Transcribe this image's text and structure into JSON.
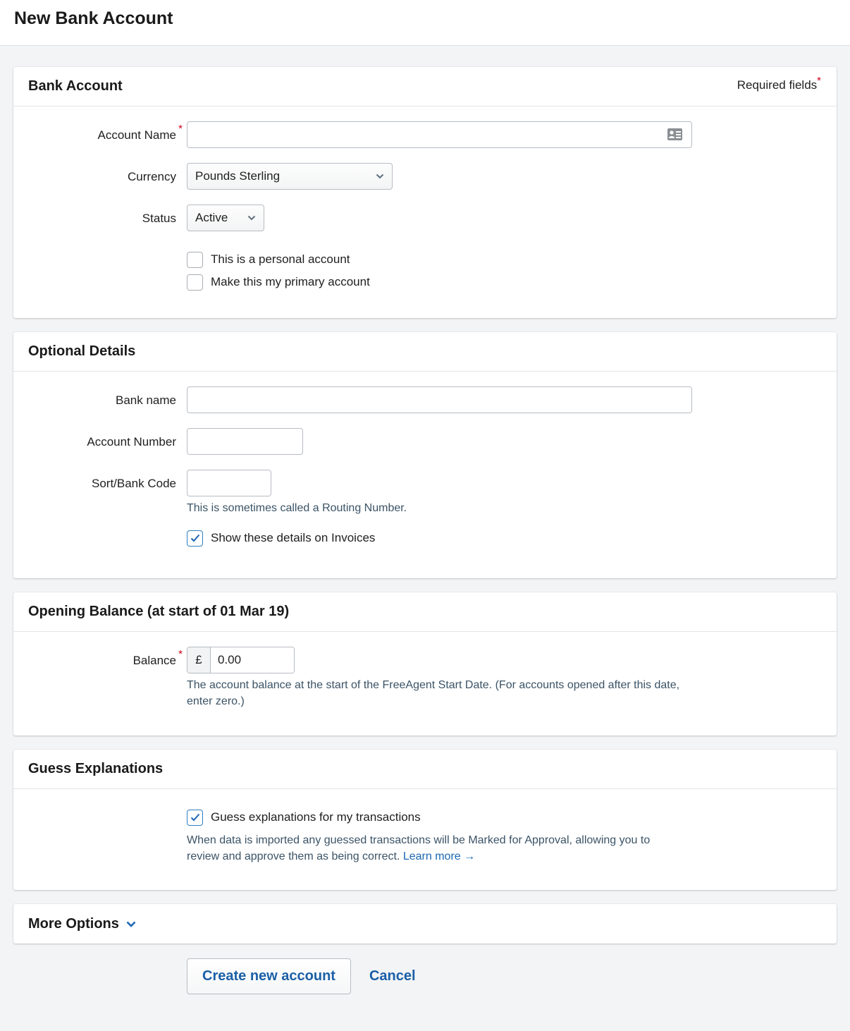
{
  "page": {
    "title": "New Bank Account"
  },
  "bank_account": {
    "heading": "Bank Account",
    "required_note": "Required fields",
    "required_marker": "*",
    "account_name": {
      "label": "Account Name",
      "value": "",
      "placeholder": "",
      "icon": "contact-card-icon"
    },
    "currency": {
      "label": "Currency",
      "selected": "Pounds Sterling"
    },
    "status": {
      "label": "Status",
      "selected": "Active"
    },
    "checkboxes": [
      {
        "label": "This is a personal account",
        "checked": false
      },
      {
        "label": "Make this my primary account",
        "checked": false
      }
    ]
  },
  "optional_details": {
    "heading": "Optional Details",
    "bank_name": {
      "label": "Bank name",
      "value": ""
    },
    "account_number": {
      "label": "Account Number",
      "value": ""
    },
    "sort_code": {
      "label": "Sort/Bank Code",
      "value": "",
      "hint": "This is sometimes called a Routing Number."
    },
    "show_on_invoices": {
      "label": "Show these details on Invoices",
      "checked": true
    }
  },
  "opening_balance": {
    "heading": "Opening Balance (at start of 01 Mar 19)",
    "balance": {
      "label": "Balance",
      "currency_symbol": "£",
      "value": "0.00"
    },
    "hint": "The account balance at the start of the FreeAgent Start Date. (For accounts opened after this date, enter zero.)"
  },
  "guess_explanations": {
    "heading": "Guess Explanations",
    "checkbox": {
      "label": "Guess explanations for my transactions",
      "checked": true
    },
    "hint": "When data is imported any guessed transactions will be Marked for Approval, allowing you to review and approve them as being correct.",
    "learn_more": "Learn more →"
  },
  "more_options": {
    "heading": "More Options",
    "icon": "chevron-down-icon"
  },
  "actions": {
    "create_label": "Create new account",
    "cancel_label": "Cancel"
  },
  "colors": {
    "accent": "#1a66b3",
    "required": "#d0021b",
    "checkbox_checked": "#2e7fc1",
    "hint": "#3b5366"
  }
}
